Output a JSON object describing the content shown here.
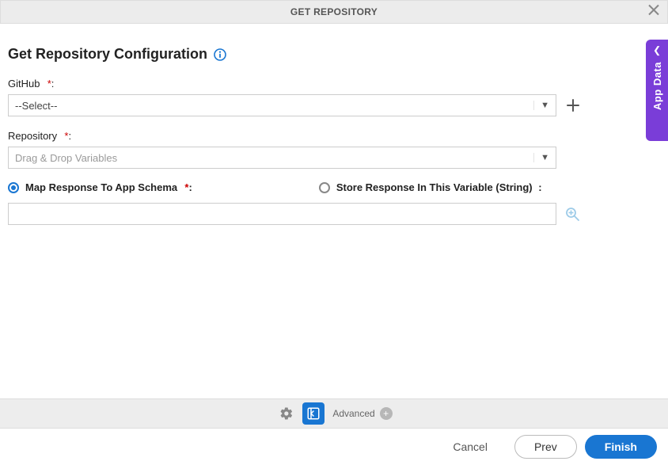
{
  "header": {
    "title": "GET REPOSITORY"
  },
  "page": {
    "title": "Get Repository Configuration"
  },
  "fields": {
    "github": {
      "label": "GitHub",
      "required_marker": "*",
      "colon": ":",
      "selected": "--Select--"
    },
    "repository": {
      "label": "Repository",
      "required_marker": "*",
      "colon": ":",
      "placeholder": "Drag & Drop Variables",
      "value": ""
    }
  },
  "response": {
    "map_label": "Map Response To App Schema",
    "map_required": "*",
    "map_colon": ":",
    "store_label": "Store Response In This Variable (String)",
    "store_colon": ":",
    "selected": "map",
    "value": ""
  },
  "footer": {
    "advanced_label": "Advanced"
  },
  "buttons": {
    "cancel": "Cancel",
    "prev": "Prev",
    "finish": "Finish"
  },
  "side_tab": {
    "label": "App Data"
  }
}
